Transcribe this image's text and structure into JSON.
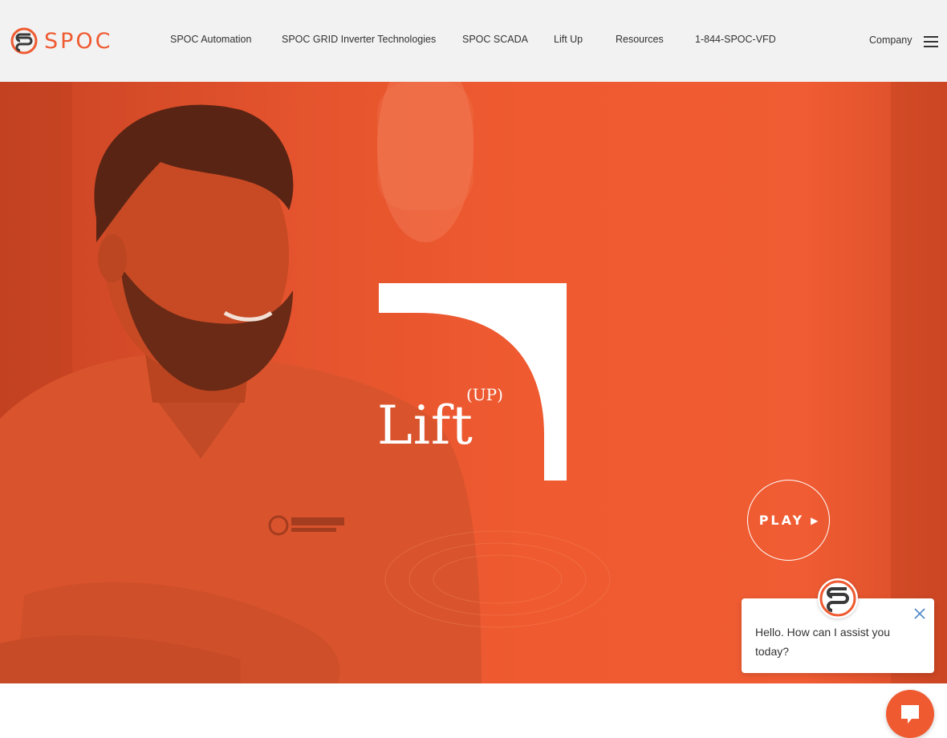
{
  "brand": {
    "name": "SPOC",
    "accent_color": "#ef5a30"
  },
  "nav": {
    "items": [
      {
        "label": "SPOC Automation"
      },
      {
        "label": "SPOC GRID Inverter Technologies"
      },
      {
        "label": "SPOC SCADA"
      },
      {
        "label": "Lift Up"
      },
      {
        "label": "Resources"
      },
      {
        "label": "1-844-SPOC-VFD"
      }
    ],
    "company_label": "Company",
    "menu_icon": "hamburger-icon"
  },
  "hero": {
    "title": "Lift",
    "title_superscript": "(UP)",
    "play_label": "PLAY",
    "play_icon": "play-icon",
    "background_color": "#ef5a30"
  },
  "chat": {
    "message": "Hello. How can I assist you today?",
    "close_icon": "close-icon",
    "launcher_icon": "chat-bubble-icon",
    "avatar_icon": "spoc-logo-icon"
  }
}
